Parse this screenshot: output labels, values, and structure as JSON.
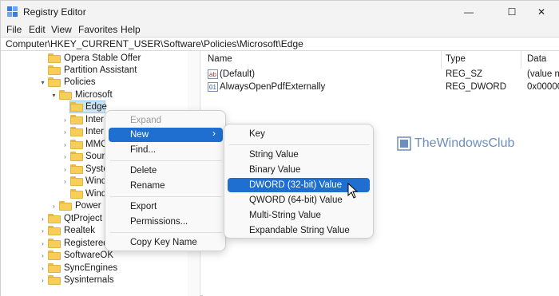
{
  "window": {
    "title": "Registry Editor",
    "min_glyph": "—",
    "max_glyph": "☐",
    "close_glyph": "✕"
  },
  "menu": [
    "File",
    "Edit",
    "View",
    "Favorites",
    "Help"
  ],
  "address": "Computer\\HKEY_CURRENT_USER\\Software\\Policies\\Microsoft\\Edge",
  "tree": {
    "items": [
      {
        "label": "Opera Stable Offer"
      },
      {
        "label": "Partition Assistant"
      },
      {
        "label": "Policies"
      },
      {
        "label": "Microsoft"
      },
      {
        "label": "Edge"
      },
      {
        "label": "Inter"
      },
      {
        "label": "Inter"
      },
      {
        "label": "MMC"
      },
      {
        "label": "Soun"
      },
      {
        "label": "Syste"
      },
      {
        "label": "Wind"
      },
      {
        "label": "Wind"
      },
      {
        "label": "Power"
      },
      {
        "label": "QtProject"
      },
      {
        "label": "Realtek"
      },
      {
        "label": "RegisteredA"
      },
      {
        "label": "SoftwareOK"
      },
      {
        "label": "SyncEngines"
      },
      {
        "label": "Sysinternals"
      }
    ]
  },
  "values": {
    "columns": [
      "Name",
      "Type",
      "Data"
    ],
    "rows": [
      {
        "name": "(Default)",
        "type": "REG_SZ",
        "data": "(value n",
        "icon": "ab"
      },
      {
        "name": "AlwaysOpenPdfExternally",
        "type": "REG_DWORD",
        "data": "0x00000",
        "icon": "01"
      }
    ]
  },
  "context_menu": {
    "items": [
      "Expand",
      "New",
      "Find...",
      "Delete",
      "Rename",
      "Export",
      "Permissions...",
      "Copy Key Name"
    ],
    "submenu_arrow": "›"
  },
  "submenu": {
    "items": [
      "Key",
      "String Value",
      "Binary Value",
      "DWORD (32-bit) Value",
      "QWORD (64-bit) Value",
      "Multi-String Value",
      "Expandable String Value"
    ]
  },
  "watermark": "TheWindowsClub",
  "colors": {
    "accent": "#1f6fd1",
    "folder": "#f7cf58",
    "selected": "#cce4f7"
  }
}
